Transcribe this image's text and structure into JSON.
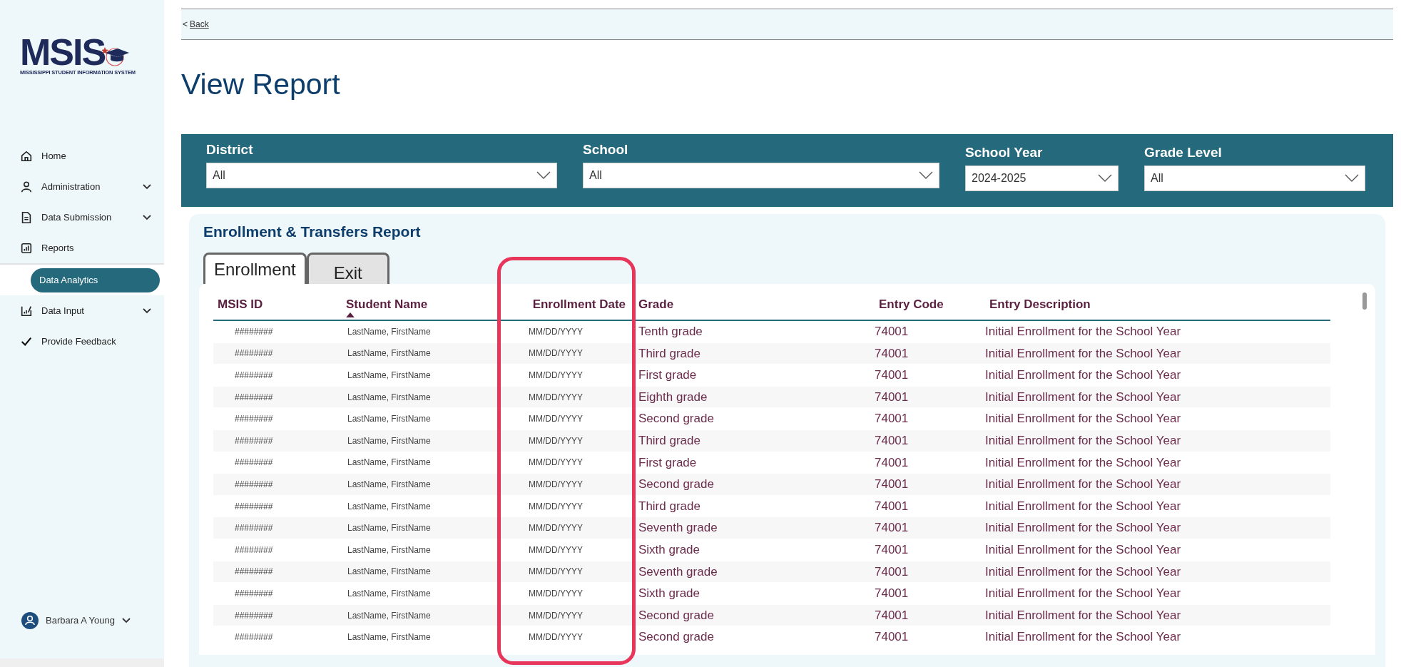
{
  "sidebar": {
    "logo": {
      "wordmark": "MSIS",
      "subtitle": "MISSISSIPPI STUDENT INFORMATION SYSTEM"
    },
    "items": [
      {
        "label": "Home",
        "has_menu": false,
        "selected": false
      },
      {
        "label": "Administration",
        "has_menu": true,
        "selected": false
      },
      {
        "label": "Data Submission",
        "has_menu": true,
        "selected": false
      },
      {
        "label": "Reports",
        "has_menu": false,
        "selected": false,
        "children": [
          {
            "label": "Data Analytics",
            "selected": true
          }
        ]
      },
      {
        "label": "Data Input",
        "has_menu": true,
        "selected": false
      },
      {
        "label": "Provide Feedback",
        "has_menu": false,
        "selected": false
      }
    ],
    "user": {
      "name": "Barbara A Young"
    }
  },
  "back_link": {
    "arrow": "<",
    "label": "Back"
  },
  "title": "View Report",
  "filters": [
    {
      "label": "District",
      "value": "All"
    },
    {
      "label": "School",
      "value": "All"
    },
    {
      "label": "School Year",
      "value": "2024-2025"
    },
    {
      "label": "Grade Level",
      "value": "All"
    }
  ],
  "report": {
    "title": "Enrollment & Transfers Report",
    "tabs": [
      {
        "label": "Enrollment",
        "selected": true
      },
      {
        "label": "Exit",
        "selected": false
      }
    ],
    "table": {
      "columns": [
        {
          "label": "MSIS ID",
          "sorted": false
        },
        {
          "label": "Student Name",
          "sorted": true
        },
        {
          "label": "Enrollment Date",
          "sorted": false
        },
        {
          "label": "Grade",
          "sorted": false
        },
        {
          "label": "Entry Code",
          "sorted": false
        },
        {
          "label": "Entry Description",
          "sorted": false
        }
      ],
      "rows": [
        [
          "########",
          "LastName, FirstName",
          "MM/DD/YYYY",
          "Tenth grade",
          "74001",
          "Initial Enrollment for the School Year"
        ],
        [
          "########",
          "LastName, FirstName",
          "MM/DD/YYYY",
          "Third grade",
          "74001",
          "Initial Enrollment for the School Year"
        ],
        [
          "########",
          "LastName, FirstName",
          "MM/DD/YYYY",
          "First grade",
          "74001",
          "Initial Enrollment for the School Year"
        ],
        [
          "########",
          "LastName, FirstName",
          "MM/DD/YYYY",
          "Eighth grade",
          "74001",
          "Initial Enrollment for the School Year"
        ],
        [
          "########",
          "LastName, FirstName",
          "MM/DD/YYYY",
          "Second grade",
          "74001",
          "Initial Enrollment for the School Year"
        ],
        [
          "########",
          "LastName, FirstName",
          "MM/DD/YYYY",
          "Third grade",
          "74001",
          "Initial Enrollment for the School Year"
        ],
        [
          "########",
          "LastName, FirstName",
          "MM/DD/YYYY",
          "First grade",
          "74001",
          "Initial Enrollment for the School Year"
        ],
        [
          "########",
          "LastName, FirstName",
          "MM/DD/YYYY",
          "Second grade",
          "74001",
          "Initial Enrollment for the School Year"
        ],
        [
          "########",
          "LastName, FirstName",
          "MM/DD/YYYY",
          "Third grade",
          "74001",
          "Initial Enrollment for the School Year"
        ],
        [
          "########",
          "LastName, FirstName",
          "MM/DD/YYYY",
          "Seventh grade",
          "74001",
          "Initial Enrollment for the School Year"
        ],
        [
          "########",
          "LastName, FirstName",
          "MM/DD/YYYY",
          "Sixth grade",
          "74001",
          "Initial Enrollment for the School Year"
        ],
        [
          "########",
          "LastName, FirstName",
          "MM/DD/YYYY",
          "Seventh grade",
          "74001",
          "Initial Enrollment for the School Year"
        ],
        [
          "########",
          "LastName, FirstName",
          "MM/DD/YYYY",
          "Sixth grade",
          "74001",
          "Initial Enrollment for the School Year"
        ],
        [
          "########",
          "LastName, FirstName",
          "MM/DD/YYYY",
          "Second grade",
          "74001",
          "Initial Enrollment for the School Year"
        ],
        [
          "########",
          "LastName, FirstName",
          "MM/DD/YYYY",
          "Second grade",
          "74001",
          "Initial Enrollment for the School Year"
        ]
      ]
    }
  },
  "annotation": {
    "kind": "highlight"
  }
}
